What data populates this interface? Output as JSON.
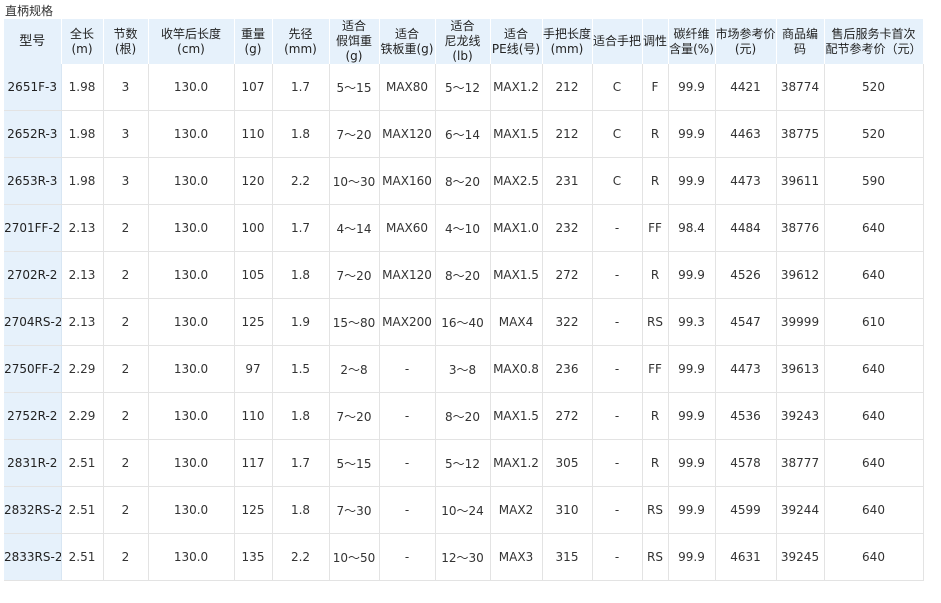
{
  "caption": "直柄规格",
  "table": {
    "headers": [
      "型号",
      "全长(m)",
      "节数(根)",
      "收竿后长度(cm)",
      "重量(g)",
      "先径 (mm)",
      "适合\n假饵重(g)",
      "适合\n铁板重(g)",
      "适合\n尼龙线(lb)",
      "适合\nPE线(号)",
      "手把长度\n(mm)",
      "适合手把",
      "调性",
      "碳纤维\n含量(%)",
      "市场参考价\n(元)",
      "商品编码",
      "售后服务卡首次\n配节参考价（元）"
    ],
    "rows": [
      [
        "2651F-3",
        "1.98",
        "3",
        "130.0",
        "107",
        "1.7",
        "5～15",
        "MAX80",
        "5～12",
        "MAX1.2",
        "212",
        "C",
        "F",
        "99.9",
        "4421",
        "38774",
        "520"
      ],
      [
        "2652R-3",
        "1.98",
        "3",
        "130.0",
        "110",
        "1.8",
        "7～20",
        "MAX120",
        "6～14",
        "MAX1.5",
        "212",
        "C",
        "R",
        "99.9",
        "4463",
        "38775",
        "520"
      ],
      [
        "2653R-3",
        "1.98",
        "3",
        "130.0",
        "120",
        "2.2",
        "10～30",
        "MAX160",
        "8～20",
        "MAX2.5",
        "231",
        "C",
        "R",
        "99.9",
        "4473",
        "39611",
        "590"
      ],
      [
        "2701FF-2",
        "2.13",
        "2",
        "130.0",
        "100",
        "1.7",
        "4～14",
        "MAX60",
        "4～10",
        "MAX1.0",
        "232",
        "-",
        "FF",
        "98.4",
        "4484",
        "38776",
        "640"
      ],
      [
        "2702R-2",
        "2.13",
        "2",
        "130.0",
        "105",
        "1.8",
        "7～20",
        "MAX120",
        "8～20",
        "MAX1.5",
        "272",
        "-",
        "R",
        "99.9",
        "4526",
        "39612",
        "640"
      ],
      [
        "2704RS-2",
        "2.13",
        "2",
        "130.0",
        "125",
        "1.9",
        "15～80",
        "MAX200",
        "16～40",
        "MAX4",
        "322",
        "-",
        "RS",
        "99.3",
        "4547",
        "39999",
        "610"
      ],
      [
        "2750FF-2",
        "2.29",
        "2",
        "130.0",
        "97",
        "1.5",
        "2～8",
        "-",
        "3～8",
        "MAX0.8",
        "236",
        "-",
        "FF",
        "99.9",
        "4473",
        "39613",
        "640"
      ],
      [
        "2752R-2",
        "2.29",
        "2",
        "130.0",
        "110",
        "1.8",
        "7～20",
        "-",
        "8～20",
        "MAX1.5",
        "272",
        "-",
        "R",
        "99.9",
        "4536",
        "39243",
        "640"
      ],
      [
        "2831R-2",
        "2.51",
        "2",
        "130.0",
        "117",
        "1.7",
        "5～15",
        "-",
        "5～12",
        "MAX1.2",
        "305",
        "-",
        "R",
        "99.9",
        "4578",
        "38777",
        "640"
      ],
      [
        "2832RS-2",
        "2.51",
        "2",
        "130.0",
        "125",
        "1.8",
        "7～30",
        "-",
        "10～24",
        "MAX2",
        "310",
        "-",
        "RS",
        "99.9",
        "4599",
        "39244",
        "640"
      ],
      [
        "2833RS-2",
        "2.51",
        "2",
        "130.0",
        "135",
        "2.2",
        "10～50",
        "-",
        "12～30",
        "MAX3",
        "315",
        "-",
        "RS",
        "99.9",
        "4631",
        "39245",
        "640"
      ]
    ]
  }
}
